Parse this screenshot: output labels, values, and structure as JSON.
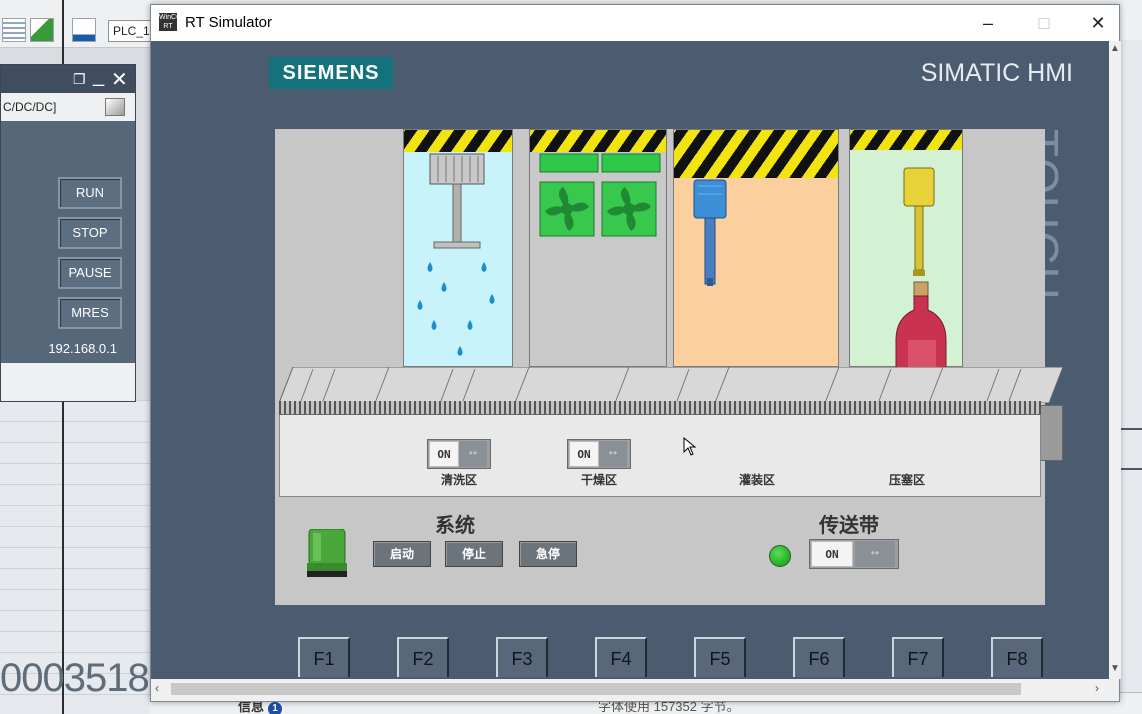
{
  "background": {
    "plc_dropdown": "PLC_1",
    "big_number": "0003518",
    "info_label": "信息",
    "info_badge": "1",
    "memory_text": "字体使用 157352 字节。"
  },
  "plc_panel": {
    "model": "C/DC/DC]",
    "buttons": [
      "RUN",
      "STOP",
      "PAUSE",
      "MRES"
    ],
    "ip_address": "192.168.0.1"
  },
  "window": {
    "title": "RT Simulator",
    "icon_text": "WinCC RT",
    "minimize": "–",
    "maximize": "□",
    "close": "✕"
  },
  "hmi": {
    "logo": "SIEMENS",
    "brand": "SIMATIC HMI",
    "side_text": "TOUCH",
    "zones": [
      {
        "label": "清洗区",
        "toggle": "ON"
      },
      {
        "label": "干燥区",
        "toggle": "ON"
      },
      {
        "label": "灌装区"
      },
      {
        "label": "压塞区"
      }
    ],
    "system": {
      "title": "系统",
      "buttons": [
        "启动",
        "停止",
        "急停"
      ]
    },
    "conveyor": {
      "title": "传送带",
      "toggle": "ON",
      "led_color": "#17a817"
    },
    "function_keys": [
      "F1",
      "F2",
      "F3",
      "F4",
      "F5",
      "F6",
      "F7",
      "F8"
    ],
    "colors": {
      "wash_bg": "#c9f3fb",
      "dry_bg": "#c9c9c9",
      "fill_bg": "#fccf9f",
      "cap_bg": "#d3f2d3",
      "panel": "#4b5c70"
    }
  }
}
